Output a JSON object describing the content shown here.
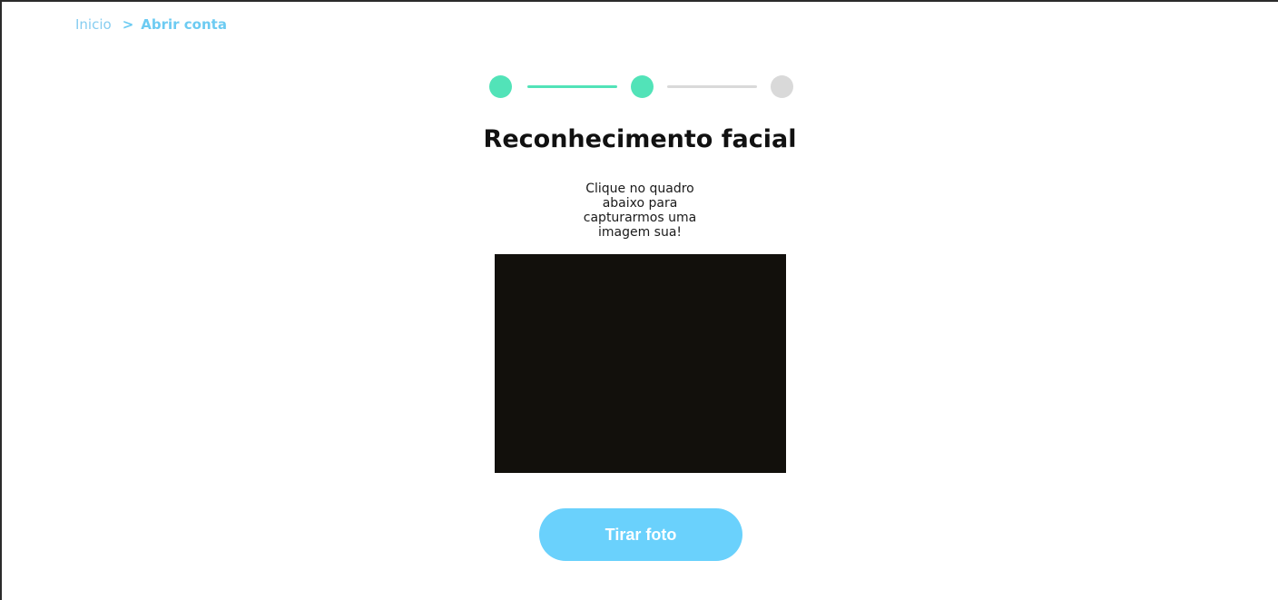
{
  "breadcrumb": {
    "home_label": "Inicio",
    "separator": ">",
    "current_label": "Abrir conta"
  },
  "stepper": {
    "current_step": 2,
    "total_steps": 3,
    "active_color": "#52e3b8",
    "inactive_color": "#d9d9d9"
  },
  "page": {
    "title": "Reconhecimento facial",
    "instructions": "Clique no quadro abaixo para capturarmos uma imagem sua!"
  },
  "camera": {
    "frame_color": "#12100c"
  },
  "actions": {
    "capture_label": "Tirar foto",
    "button_color": "#6ad1fc"
  }
}
